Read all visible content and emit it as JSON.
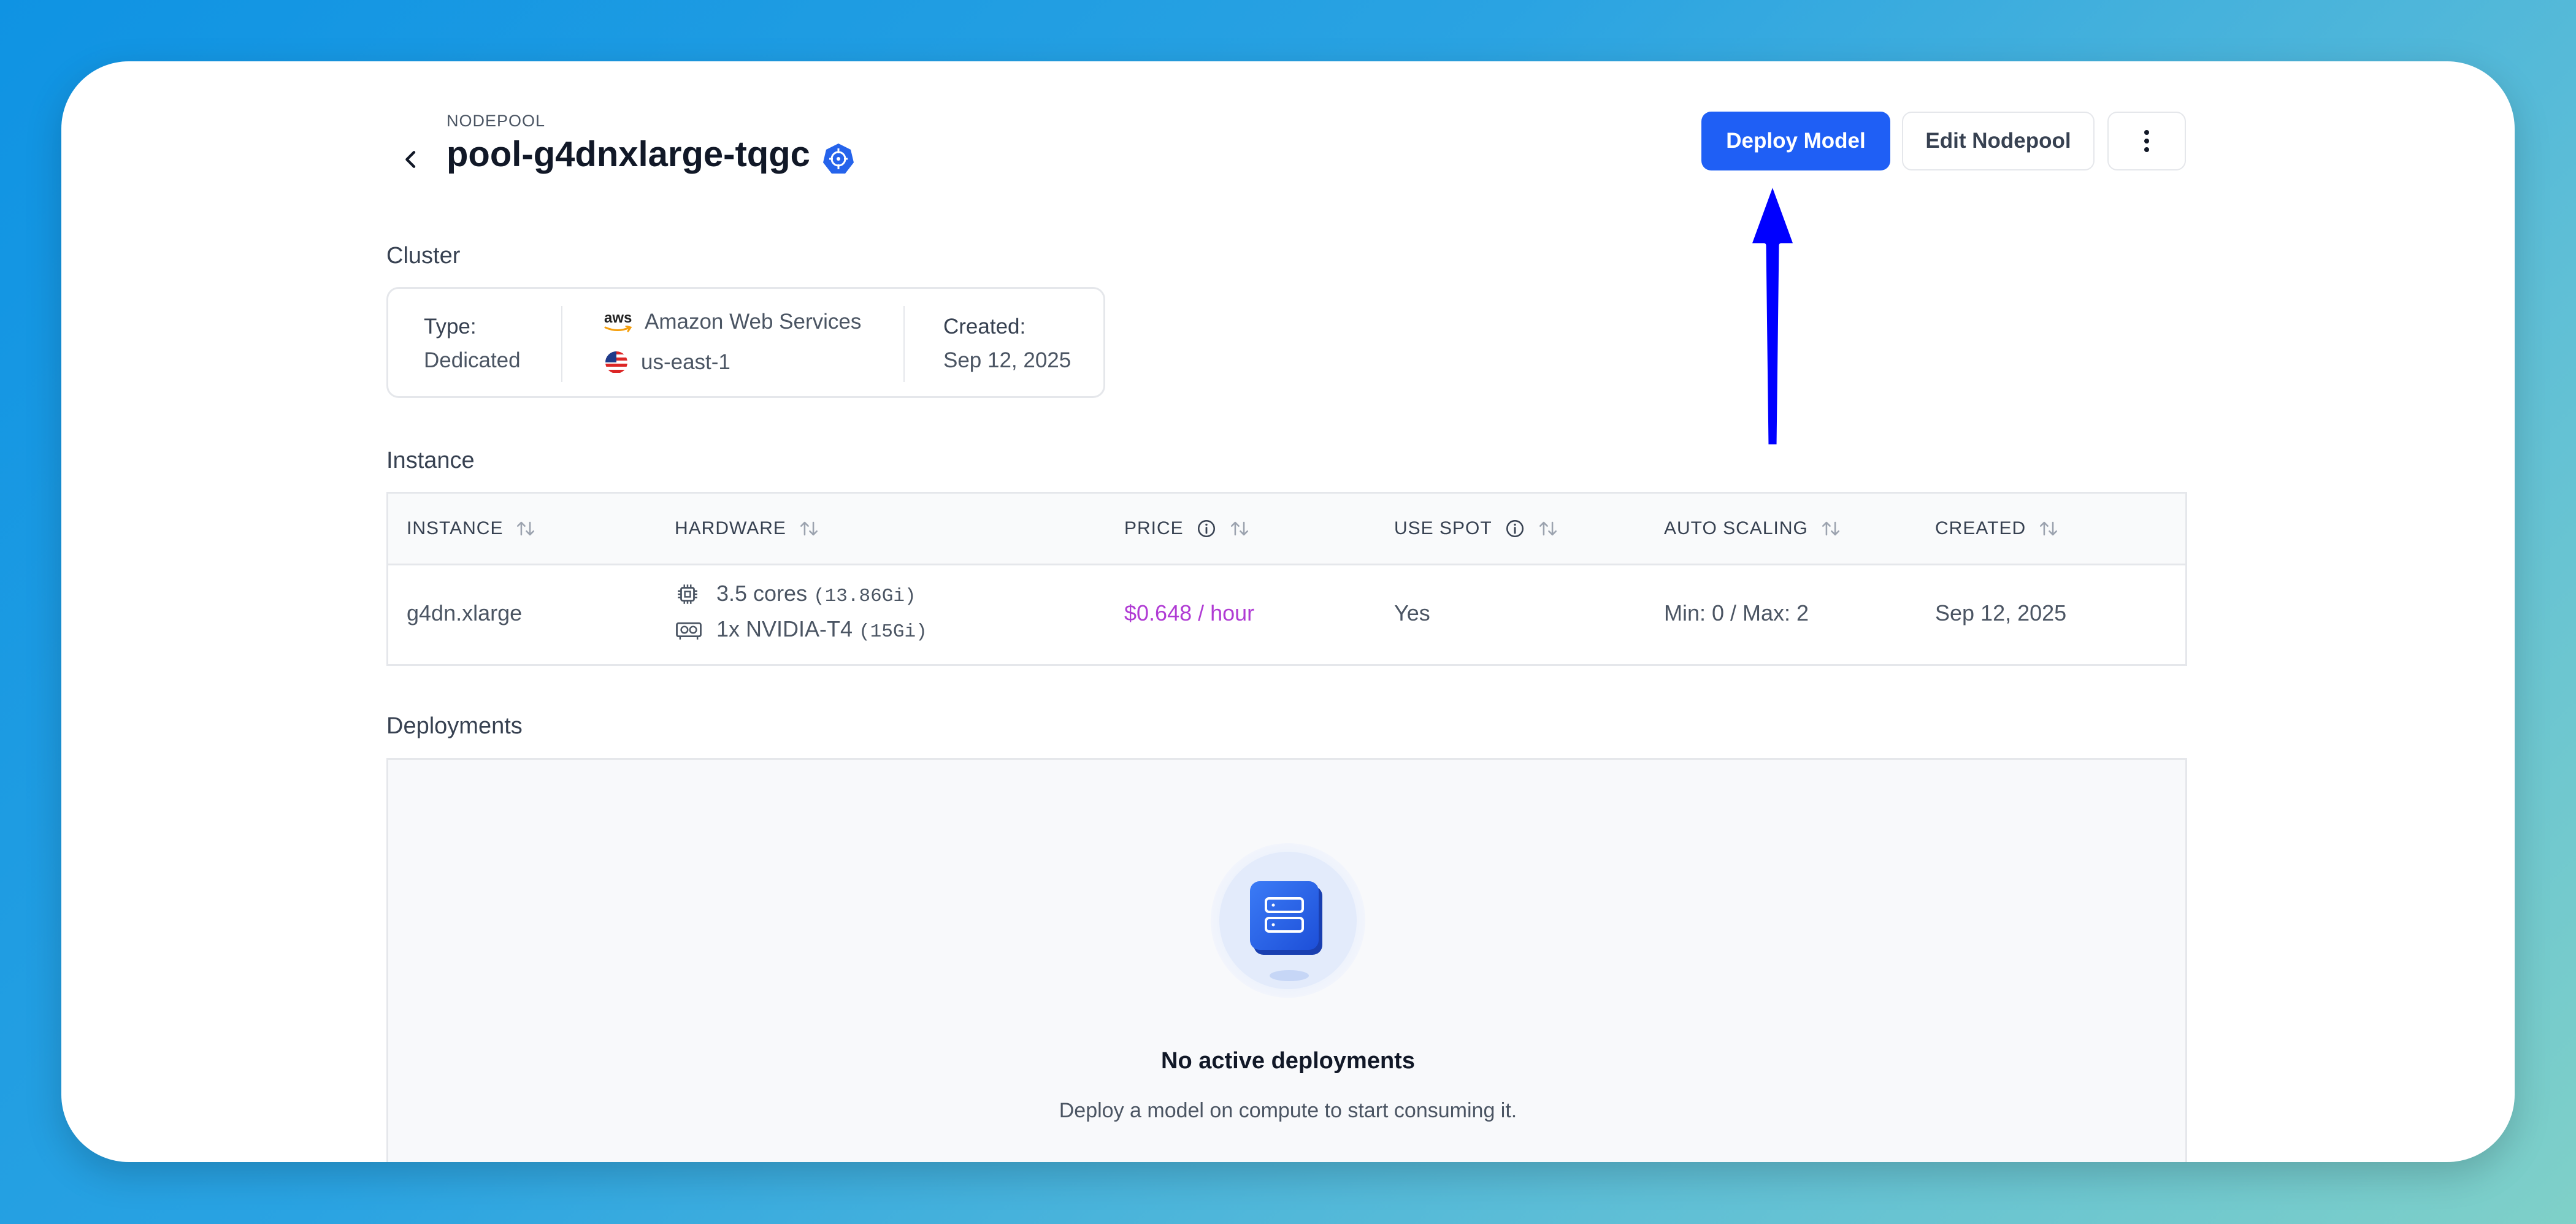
{
  "header": {
    "eyebrow": "NODEPOOL",
    "title": "pool-g4dnxlarge-tqgc",
    "deploy_label": "Deploy Model",
    "edit_label": "Edit Nodepool"
  },
  "cluster": {
    "section_label": "Cluster",
    "type_label": "Type:",
    "type_value": "Dedicated",
    "provider_logo": "aws",
    "provider": "Amazon Web Services",
    "region": "us-east-1",
    "created_label": "Created:",
    "created_value": "Sep 12, 2025"
  },
  "instance": {
    "section_label": "Instance",
    "columns": [
      "INSTANCE",
      "HARDWARE",
      "PRICE",
      "USE SPOT",
      "AUTO SCALING",
      "CREATED"
    ],
    "row": {
      "instance": "g4dn.xlarge",
      "cpu": "3.5 cores",
      "cpu_mem": "(13.86Gi)",
      "gpu": "1x NVIDIA-T4",
      "gpu_mem": "(15Gi)",
      "price": "$0.648 / hour",
      "use_spot": "Yes",
      "auto_scaling": "Min: 0 / Max: 2",
      "created": "Sep 12, 2025"
    }
  },
  "deployments": {
    "section_label": "Deployments",
    "empty_title": "No active deployments",
    "empty_sub": "Deploy a model on compute to start consuming it."
  },
  "colors": {
    "primary": "#1f5ff5",
    "price": "#b03bd4",
    "arrow": "#0000ff"
  }
}
